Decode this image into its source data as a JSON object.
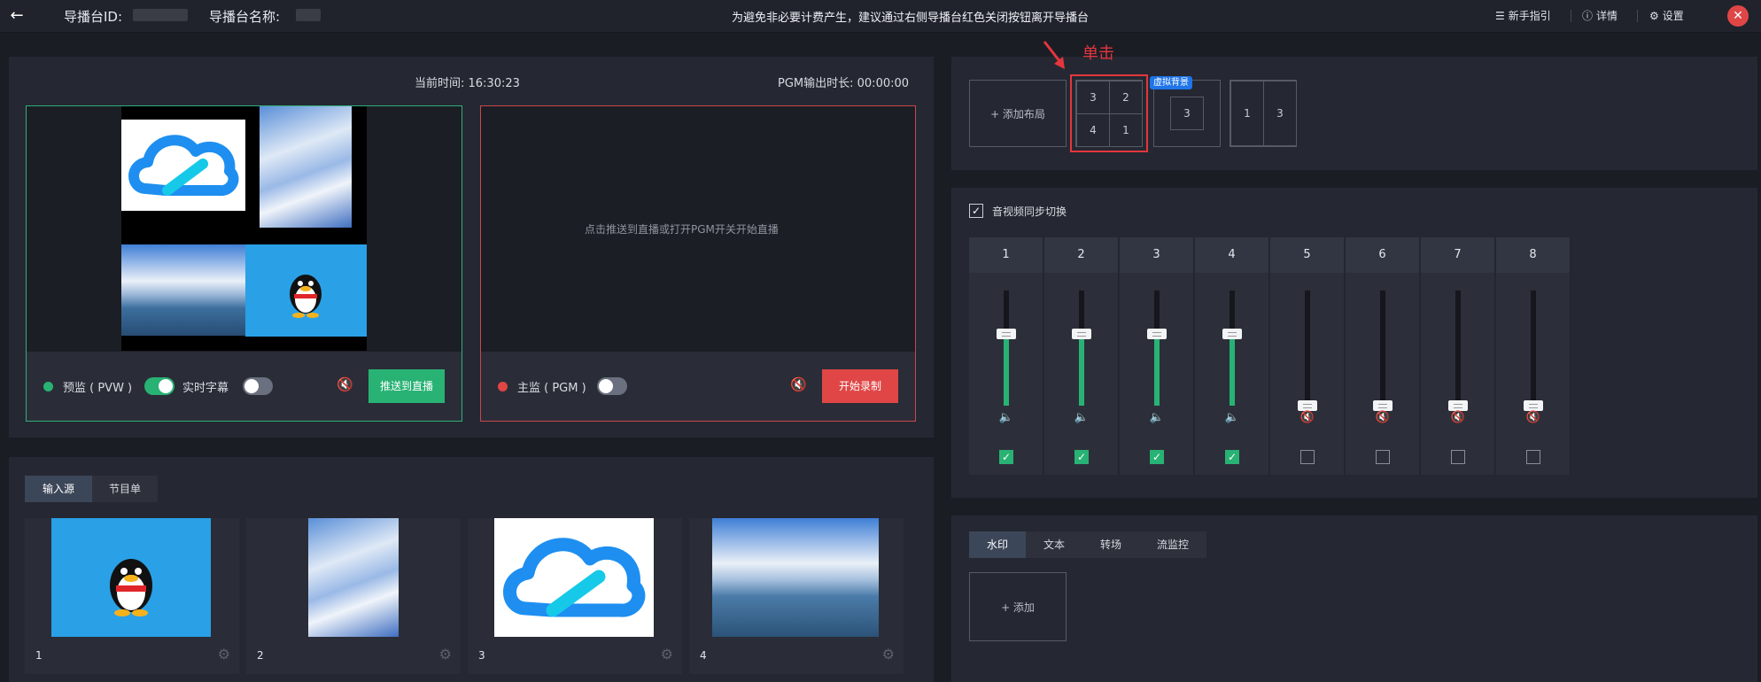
{
  "topbar": {
    "back_icon": "arrow-left-icon",
    "id_label": "导播台ID:",
    "name_label": "导播台名称:",
    "notice": "为避免非必要计费产生，建议通过右侧导播台红色关闭按钮离开导播台",
    "guide_label": "新手指引",
    "detail_label": "详情",
    "settings_label": "设置",
    "close_icon": "close-icon"
  },
  "monitor": {
    "current_time_label": "当前时间: 16:30:23",
    "pgm_duration_label": "PGM输出时长: 00:00:00",
    "pvw_label": "预监 ( PVW )",
    "subtitle_label": "实时字幕",
    "push_button": "推送到直播",
    "pgm_label": "主监 ( PGM )",
    "pgm_placeholder": "点击推送到直播或打开PGM开关开始直播",
    "record_button": "开始录制",
    "pvw_toggle_on": true,
    "subtitle_toggle_on": false,
    "pgm_toggle_on": false
  },
  "layouts": {
    "add_label": "+ 添加布局",
    "annotation": "单击",
    "virtual_bg_badge": "虚拟背景",
    "grid_cells": [
      "3",
      "2",
      "4",
      "1"
    ],
    "virtual_cell": "3",
    "split_cells": [
      "1",
      "3"
    ]
  },
  "mixer": {
    "sync_label": "音视频同步切换",
    "sync_checked": true,
    "channels": [
      {
        "num": "1",
        "level": 0.62,
        "muted": false,
        "checked": true
      },
      {
        "num": "2",
        "level": 0.62,
        "muted": false,
        "checked": true
      },
      {
        "num": "3",
        "level": 0.62,
        "muted": false,
        "checked": true
      },
      {
        "num": "4",
        "level": 0.62,
        "muted": false,
        "checked": true
      },
      {
        "num": "5",
        "level": 0.0,
        "muted": true,
        "checked": false
      },
      {
        "num": "6",
        "level": 0.0,
        "muted": true,
        "checked": false
      },
      {
        "num": "7",
        "level": 0.0,
        "muted": true,
        "checked": false
      },
      {
        "num": "8",
        "level": 0.0,
        "muted": true,
        "checked": false
      }
    ]
  },
  "sources": {
    "tabs": [
      "输入源",
      "节目单"
    ],
    "items": [
      "1",
      "2",
      "3",
      "4"
    ]
  },
  "overlay": {
    "tabs": [
      "水印",
      "文本",
      "转场",
      "流监控"
    ],
    "add_label": "+ 添加"
  },
  "colors": {
    "accent_green": "#28b274",
    "accent_red": "#e04646",
    "background": "#1b1d25"
  }
}
